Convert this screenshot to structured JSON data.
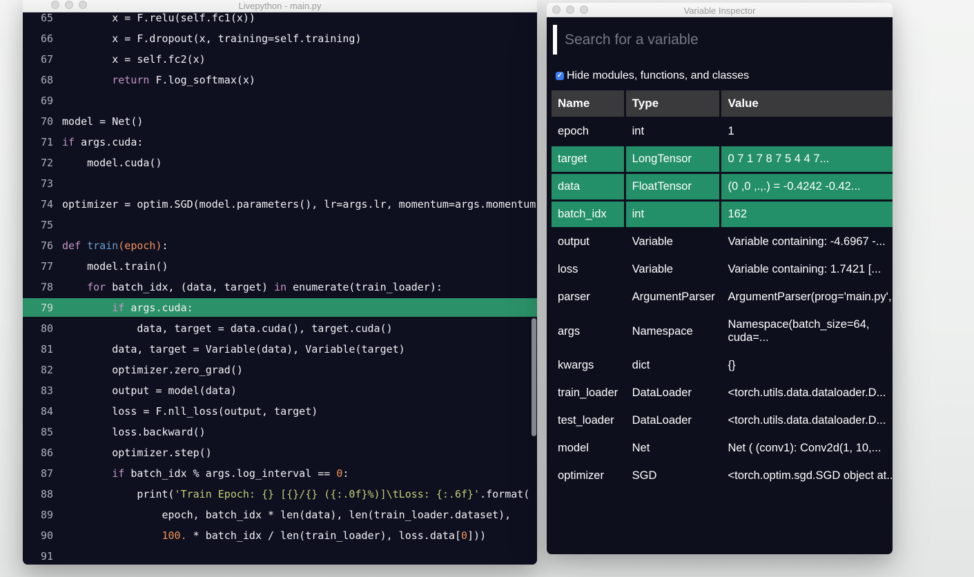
{
  "editor": {
    "title": "Livepython - main.py",
    "window_buttons": [
      "close",
      "minimize",
      "zoom"
    ],
    "highlight_line": 79,
    "colors": {
      "background": "#0e101f",
      "plain": "#f2f2f5",
      "keyword": "#c594c5",
      "function": "#6c9ece",
      "number": "#f29258",
      "string": "#c0cf76",
      "line_number": "#aeb1bc",
      "active_line_background": "#2b9168"
    },
    "lines": [
      {
        "num": 65,
        "tokens": [
          [
            "p",
            "        x = F.relu(self.fc1(x))"
          ]
        ]
      },
      {
        "num": 66,
        "tokens": [
          [
            "p",
            "        x = F.dropout(x, training=self.training)"
          ]
        ]
      },
      {
        "num": 67,
        "tokens": [
          [
            "p",
            "        x = self.fc2(x)"
          ]
        ]
      },
      {
        "num": 68,
        "tokens": [
          [
            "p",
            "        "
          ],
          [
            "k",
            "return"
          ],
          [
            "p",
            " F.log_softmax(x)"
          ]
        ]
      },
      {
        "num": 69,
        "tokens": []
      },
      {
        "num": 70,
        "tokens": [
          [
            "p",
            "model = Net()"
          ]
        ]
      },
      {
        "num": 71,
        "tokens": [
          [
            "k",
            "if"
          ],
          [
            "p",
            " args.cuda:"
          ]
        ]
      },
      {
        "num": 72,
        "tokens": [
          [
            "p",
            "    model.cuda()"
          ]
        ]
      },
      {
        "num": 73,
        "tokens": []
      },
      {
        "num": 74,
        "tokens": [
          [
            "p",
            "optimizer = optim.SGD(model.parameters(), lr=args.lr, momentum=args.momentum)"
          ]
        ]
      },
      {
        "num": 75,
        "tokens": []
      },
      {
        "num": 76,
        "tokens": [
          [
            "k",
            "def"
          ],
          [
            "p",
            " "
          ],
          [
            "f",
            "train"
          ],
          [
            "o",
            "(epoch)"
          ],
          [
            "p",
            ":"
          ]
        ]
      },
      {
        "num": 77,
        "tokens": [
          [
            "p",
            "    model.train()"
          ]
        ]
      },
      {
        "num": 78,
        "tokens": [
          [
            "p",
            "    "
          ],
          [
            "k",
            "for"
          ],
          [
            "p",
            " batch_idx, (data, target) "
          ],
          [
            "k",
            "in"
          ],
          [
            "p",
            " enumerate(train_loader):"
          ]
        ]
      },
      {
        "num": 79,
        "tokens": [
          [
            "p",
            "        "
          ],
          [
            "k",
            "if"
          ],
          [
            "p",
            " args.cuda:"
          ]
        ]
      },
      {
        "num": 80,
        "tokens": [
          [
            "p",
            "            data, target = data.cuda(), target.cuda()"
          ]
        ]
      },
      {
        "num": 81,
        "tokens": [
          [
            "p",
            "        data, target = Variable(data), Variable(target)"
          ]
        ]
      },
      {
        "num": 82,
        "tokens": [
          [
            "p",
            "        optimizer.zero_grad()"
          ]
        ]
      },
      {
        "num": 83,
        "tokens": [
          [
            "p",
            "        output = model(data)"
          ]
        ]
      },
      {
        "num": 84,
        "tokens": [
          [
            "p",
            "        loss = F.nll_loss(output, target)"
          ]
        ]
      },
      {
        "num": 85,
        "tokens": [
          [
            "p",
            "        loss.backward()"
          ]
        ]
      },
      {
        "num": 86,
        "tokens": [
          [
            "p",
            "        optimizer.step()"
          ]
        ]
      },
      {
        "num": 87,
        "tokens": [
          [
            "p",
            "        "
          ],
          [
            "k",
            "if"
          ],
          [
            "p",
            " batch_idx % args.log_interval == "
          ],
          [
            "o",
            "0"
          ],
          [
            "p",
            ":"
          ]
        ]
      },
      {
        "num": 88,
        "tokens": [
          [
            "p",
            "            print("
          ],
          [
            "s",
            "'Train Epoch: {} [{}/{} ({:.0f}%)]\\tLoss: {:.6f}'"
          ],
          [
            "p",
            ".format("
          ]
        ]
      },
      {
        "num": 89,
        "tokens": [
          [
            "p",
            "                epoch, batch_idx * len(data), len(train_loader.dataset),"
          ]
        ]
      },
      {
        "num": 90,
        "tokens": [
          [
            "p",
            "                "
          ],
          [
            "o",
            "100."
          ],
          [
            "p",
            " * batch_idx / len(train_loader), loss.data["
          ],
          [
            "o",
            "0"
          ],
          [
            "p",
            "]))"
          ]
        ]
      },
      {
        "num": 91,
        "tokens": []
      }
    ]
  },
  "inspector": {
    "title": "Variable Inspector",
    "window_buttons": [
      "close",
      "minimize",
      "zoom"
    ],
    "search_placeholder": "Search for a variable",
    "search_value": "",
    "checkbox": {
      "label": "Hide modules, functions, and classes",
      "checked": true
    },
    "checkbox_color": "#3b7cf5",
    "row_highlight_color": "#24906a",
    "table": {
      "columns": [
        "Name",
        "Type",
        "Value"
      ],
      "rows": [
        {
          "name": "epoch",
          "type": "int",
          "value": "1",
          "highlight": false
        },
        {
          "name": "target",
          "type": "LongTensor",
          "value": "0 7 1 7 8 7 5 4 4 7...",
          "highlight": true
        },
        {
          "name": "data",
          "type": "FloatTensor",
          "value": "(0 ,0 ,.,.) = -0.4242 -0.42...",
          "highlight": true
        },
        {
          "name": "batch_idx",
          "type": "int",
          "value": "162",
          "highlight": true
        },
        {
          "name": "output",
          "type": "Variable",
          "value": "Variable containing: -4.6967 -...",
          "highlight": false
        },
        {
          "name": "loss",
          "type": "Variable",
          "value": "Variable containing: 1.7421 [...",
          "highlight": false
        },
        {
          "name": "parser",
          "type": "ArgumentParser",
          "value": "ArgumentParser(prog='main.py',...",
          "highlight": false
        },
        {
          "name": "args",
          "type": "Namespace",
          "value": "Namespace(batch_size=64, cuda=...",
          "highlight": false,
          "wrap": true
        },
        {
          "name": "kwargs",
          "type": "dict",
          "value": "{}",
          "highlight": false
        },
        {
          "name": "train_loader",
          "type": "DataLoader",
          "value": "<torch.utils.data.dataloader.D...",
          "highlight": false
        },
        {
          "name": "test_loader",
          "type": "DataLoader",
          "value": "<torch.utils.data.dataloader.D...",
          "highlight": false
        },
        {
          "name": "model",
          "type": "Net",
          "value": "Net ( (conv1): Conv2d(1, 10,...",
          "highlight": false
        },
        {
          "name": "optimizer",
          "type": "SGD",
          "value": "<torch.optim.sgd.SGD object at...",
          "highlight": false
        }
      ]
    }
  }
}
